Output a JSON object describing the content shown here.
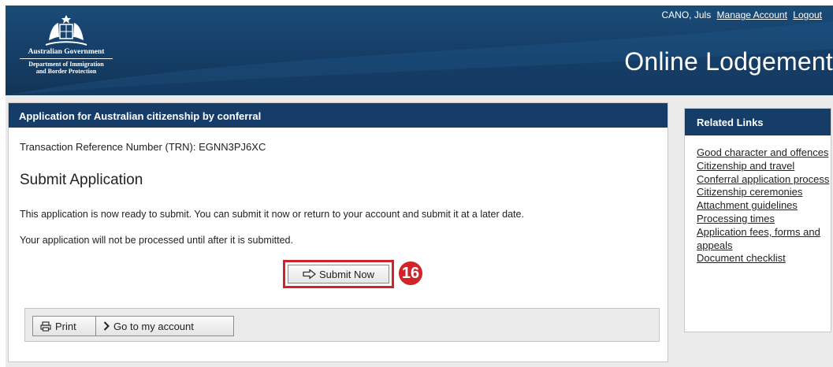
{
  "header": {
    "gov_name": "Australian Government",
    "dept_line1": "Department of Immigration",
    "dept_line2": "and Border Protection",
    "user_name": "CANO, Juls",
    "manage_account": "Manage Account",
    "logout": "Logout",
    "title": "Online Lodgement"
  },
  "main": {
    "panel_title": "Application for Australian citizenship by conferral",
    "trn": "Transaction Reference Number (TRN): EGNN3PJ6XC",
    "section_title": "Submit Application",
    "para1": "This application is now ready to submit. You can submit it now or return to your account and submit it at a later date.",
    "para2": "Your application will not be processed until after it is submitted.",
    "submit_label": "Submit Now",
    "step_number": "16",
    "print_label": "Print",
    "account_label": "Go to my account"
  },
  "sidebar": {
    "title": "Related Links",
    "links": [
      "Good character and offences",
      "Citizenship and travel",
      "Conferral application process",
      "Citizenship ceremonies",
      "Attachment guidelines",
      "Processing times",
      "Application fees, forms and appeals",
      "Document checklist"
    ]
  },
  "colors": {
    "header_blue": "#163d67",
    "highlight_red": "#d2232a"
  },
  "icons": [
    "coat-of-arms-icon",
    "arrow-right-icon",
    "print-icon",
    "chevron-right-icon"
  ]
}
